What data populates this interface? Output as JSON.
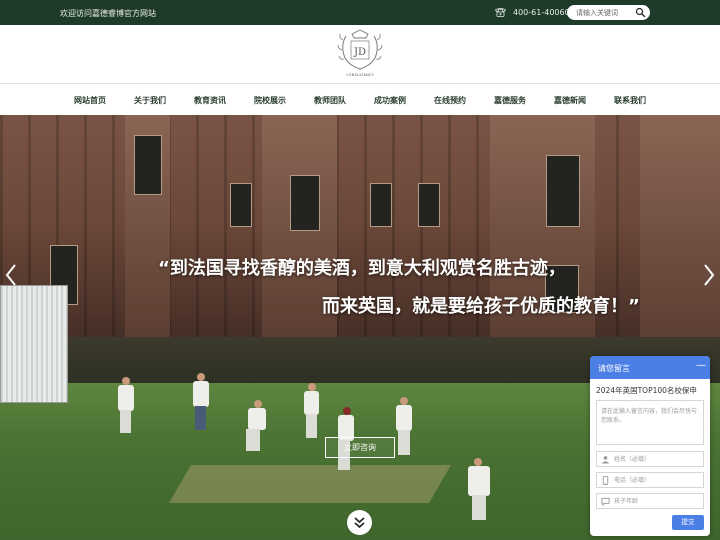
{
  "topbar": {
    "welcome": "欢迎访问嘉德睿博官方网站",
    "phone": "400-61-40060",
    "search_placeholder": "请输入关键词"
  },
  "logo": {
    "initials": "JD",
    "subtitle": "CONSULTANCY"
  },
  "nav": {
    "items": [
      "网站首页",
      "关于我们",
      "教育资讯",
      "院校展示",
      "教师团队",
      "成功案例",
      "在线预约",
      "嘉德服务",
      "嘉德新闻",
      "联系我们"
    ]
  },
  "banner": {
    "quote_line1": "“到法国寻找香醇的美酒，到意大利观赏名胜古迹，",
    "quote_line2": "而来英国，就是要给孩子优质的教育！”",
    "consult_button": "立即咨询"
  },
  "widget": {
    "title": "请您留言",
    "message": "2024年英国TOP100名校保申",
    "textarea_placeholder": "请在此输入留言内容，我们会尽快与您联系。",
    "name_placeholder": "姓名（必填）",
    "phone_placeholder": "电话（必填）",
    "grade_placeholder": "孩子年龄",
    "submit": "提交"
  },
  "colors": {
    "topbar": "#1e3a29",
    "nav_text": "#2b3d31",
    "widget_accent": "#4c7fe6"
  }
}
